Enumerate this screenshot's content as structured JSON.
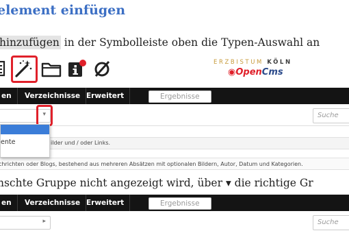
{
  "document": {
    "heading": "element einfügen",
    "line1_highlight": "hinzufügen",
    "line1_rest": " in der Symbolleiste oben die Typen-Auswahl an",
    "line2_before": "nschte Gruppe nicht angezeigt wird, über ",
    "line2_arrow": "▾",
    "line2_after": " die richtige Gr"
  },
  "toolbar": {
    "icons": [
      "document-icon",
      "magic-wand-icon",
      "folder-icon",
      "info-icon",
      "block-icon"
    ],
    "highlighted_icon": "magic-wand-icon",
    "highlight_color": "#e0202a"
  },
  "logo": {
    "top_line_prefix": "ERZBISTUM",
    "top_line_suffix": "KÖLN",
    "brand_open": "Open",
    "brand_cms": "Cms"
  },
  "panel1": {
    "tabs": [
      "en",
      "Verzeichnisse",
      "Erweitert"
    ],
    "results_button": "Ergebnisse",
    "search_placeholder": "Suche",
    "dropdown_items": [
      "",
      "ente"
    ],
    "row1_text": "ilder und / oder Links.",
    "row2_text": "chrichten oder Blogs, bestehend aus mehreren Absätzen mit optionalen Bildern, Autor, Datum und Kategorien."
  },
  "panel2": {
    "tabs": [
      "en",
      "Verzeichnisse",
      "Erweitert"
    ],
    "results_button": "Ergebnisse",
    "search_placeholder": "Suche"
  },
  "colors": {
    "heading": "#3c6fc4",
    "navbar": "#141414",
    "selection": "#3b7dd8",
    "highlight_box": "#e0202a"
  }
}
